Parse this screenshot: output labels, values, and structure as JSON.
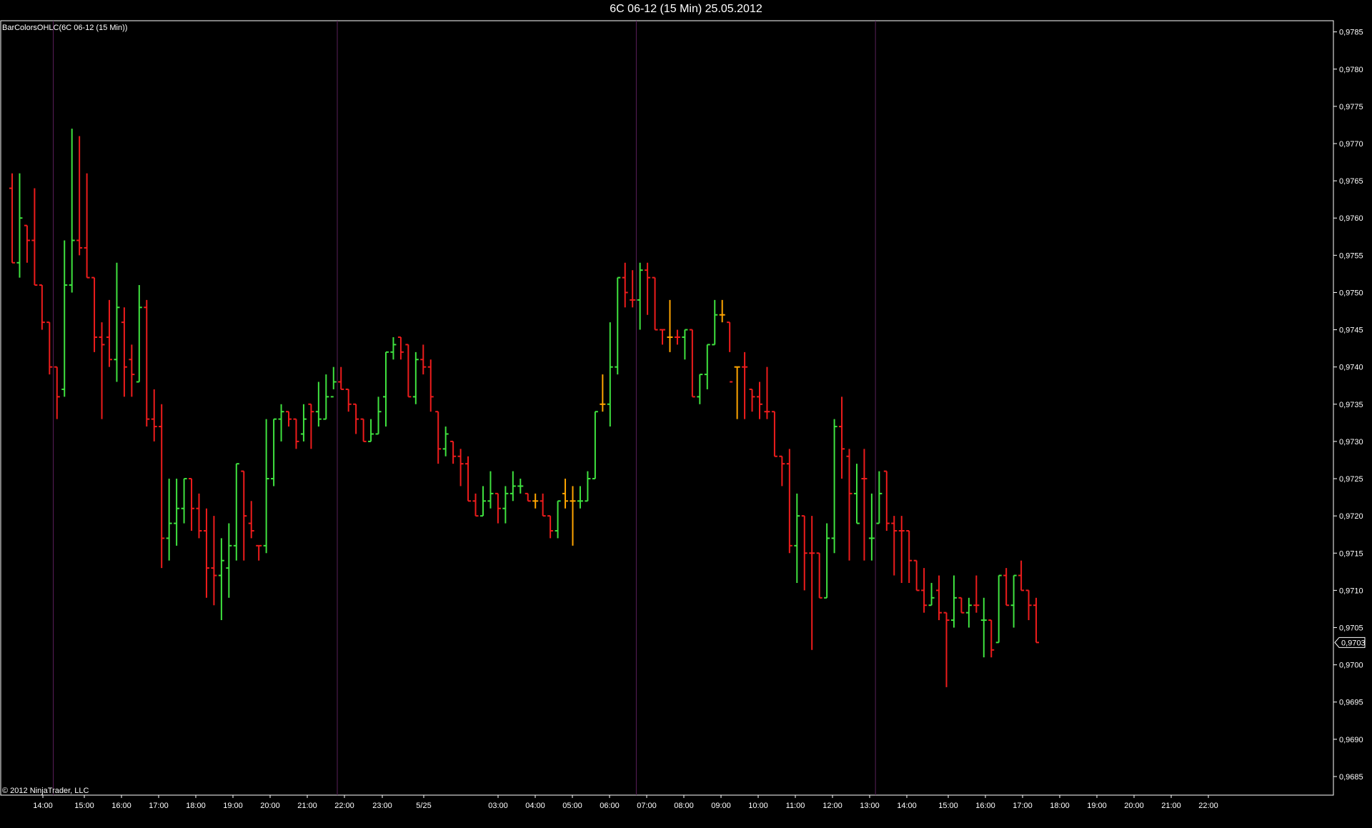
{
  "window": {
    "title": "6C 06-12 (15 Min)  25.05.2012",
    "indicator_label": "BarColorsOHLC(6C 06-12 (15 Min))",
    "copyright": "© 2012 NinjaTrader, LLC"
  },
  "colors": {
    "background": "#000000",
    "axis": "#ffffff",
    "separator": "#5a1f5a",
    "up": "#3fe23f",
    "down": "#ee1c1c",
    "neutral": "#ffa500"
  },
  "chart_data": {
    "type": "ohlc",
    "title": "6C 06-12 (15 Min)  25.05.2012",
    "ylim": [
      0.96825,
      0.97865
    ],
    "y_ticks": [
      "0,9685",
      "0,9690",
      "0,9695",
      "0,9700",
      "0,9705",
      "0,9710",
      "0,9715",
      "0,9720",
      "0,9725",
      "0,9730",
      "0,9735",
      "0,9740",
      "0,9745",
      "0,9750",
      "0,9755",
      "0,9760",
      "0,9765",
      "0,9770",
      "0,9775",
      "0,9780",
      "0,9785"
    ],
    "x_ticks": [
      "14:00",
      "15:00",
      "16:00",
      "17:00",
      "18:00",
      "19:00",
      "20:00",
      "21:00",
      "22:00",
      "23:00",
      "5/25",
      "03:00",
      "04:00",
      "05:00",
      "06:00",
      "07:00",
      "08:00",
      "09:00",
      "10:00",
      "11:00",
      "12:00",
      "13:00",
      "14:00",
      "15:00",
      "16:00",
      "17:00",
      "18:00",
      "19:00",
      "20:00",
      "21:00",
      "22:00"
    ],
    "last_price_label": "0,9703",
    "last_price": 0.9703,
    "session_breaks_after_bar": [
      5,
      43,
      83,
      115
    ],
    "bars": [
      {
        "o": 0.9764,
        "h": 0.9766,
        "l": 0.9754,
        "c": 0.9754,
        "col": "down"
      },
      {
        "o": 0.9754,
        "h": 0.9766,
        "l": 0.9752,
        "c": 0.976,
        "col": "up"
      },
      {
        "o": 0.9759,
        "h": 0.9759,
        "l": 0.9754,
        "c": 0.9757,
        "col": "down"
      },
      {
        "o": 0.9757,
        "h": 0.9764,
        "l": 0.9751,
        "c": 0.9751,
        "col": "down"
      },
      {
        "o": 0.9751,
        "h": 0.9751,
        "l": 0.9745,
        "c": 0.9746,
        "col": "down"
      },
      {
        "o": 0.9746,
        "h": 0.9746,
        "l": 0.9739,
        "c": 0.974,
        "col": "down"
      },
      {
        "o": 0.974,
        "h": 0.974,
        "l": 0.9733,
        "c": 0.9736,
        "col": "down"
      },
      {
        "o": 0.9737,
        "h": 0.9757,
        "l": 0.9736,
        "c": 0.9751,
        "col": "up"
      },
      {
        "o": 0.9751,
        "h": 0.9772,
        "l": 0.975,
        "c": 0.9757,
        "col": "up"
      },
      {
        "o": 0.9757,
        "h": 0.9771,
        "l": 0.9755,
        "c": 0.9756,
        "col": "down"
      },
      {
        "o": 0.9756,
        "h": 0.9766,
        "l": 0.9752,
        "c": 0.9752,
        "col": "down"
      },
      {
        "o": 0.9752,
        "h": 0.9752,
        "l": 0.9742,
        "c": 0.9744,
        "col": "down"
      },
      {
        "o": 0.9744,
        "h": 0.9746,
        "l": 0.9733,
        "c": 0.9743,
        "col": "down"
      },
      {
        "o": 0.9744,
        "h": 0.9749,
        "l": 0.974,
        "c": 0.9741,
        "col": "down"
      },
      {
        "o": 0.9741,
        "h": 0.9754,
        "l": 0.9738,
        "c": 0.9748,
        "col": "up"
      },
      {
        "o": 0.9746,
        "h": 0.9748,
        "l": 0.9736,
        "c": 0.974,
        "col": "down"
      },
      {
        "o": 0.9741,
        "h": 0.9743,
        "l": 0.9736,
        "c": 0.9739,
        "col": "down"
      },
      {
        "o": 0.9738,
        "h": 0.9751,
        "l": 0.9738,
        "c": 0.9748,
        "col": "up"
      },
      {
        "o": 0.9748,
        "h": 0.9749,
        "l": 0.9732,
        "c": 0.9733,
        "col": "down"
      },
      {
        "o": 0.9733,
        "h": 0.9737,
        "l": 0.973,
        "c": 0.9732,
        "col": "down"
      },
      {
        "o": 0.9732,
        "h": 0.9735,
        "l": 0.9713,
        "c": 0.9717,
        "col": "down"
      },
      {
        "o": 0.9717,
        "h": 0.9725,
        "l": 0.9714,
        "c": 0.9719,
        "col": "up"
      },
      {
        "o": 0.9719,
        "h": 0.9725,
        "l": 0.9716,
        "c": 0.9721,
        "col": "up"
      },
      {
        "o": 0.9721,
        "h": 0.9725,
        "l": 0.9719,
        "c": 0.9725,
        "col": "up"
      },
      {
        "o": 0.9725,
        "h": 0.9725,
        "l": 0.9718,
        "c": 0.9721,
        "col": "down"
      },
      {
        "o": 0.9721,
        "h": 0.9723,
        "l": 0.9717,
        "c": 0.9718,
        "col": "down"
      },
      {
        "o": 0.9718,
        "h": 0.9721,
        "l": 0.9709,
        "c": 0.9713,
        "col": "down"
      },
      {
        "o": 0.9713,
        "h": 0.972,
        "l": 0.9708,
        "c": 0.9712,
        "col": "down"
      },
      {
        "o": 0.9712,
        "h": 0.9717,
        "l": 0.9706,
        "c": 0.9714,
        "col": "up"
      },
      {
        "o": 0.9713,
        "h": 0.9719,
        "l": 0.9709,
        "c": 0.9716,
        "col": "up"
      },
      {
        "o": 0.9716,
        "h": 0.9727,
        "l": 0.9714,
        "c": 0.9727,
        "col": "up"
      },
      {
        "o": 0.9726,
        "h": 0.9726,
        "l": 0.9714,
        "c": 0.972,
        "col": "down"
      },
      {
        "o": 0.9719,
        "h": 0.9722,
        "l": 0.9717,
        "c": 0.9718,
        "col": "down"
      },
      {
        "o": 0.9716,
        "h": 0.9716,
        "l": 0.9714,
        "c": 0.9716,
        "col": "down"
      },
      {
        "o": 0.9716,
        "h": 0.9733,
        "l": 0.9715,
        "c": 0.9725,
        "col": "up"
      },
      {
        "o": 0.9725,
        "h": 0.9733,
        "l": 0.9724,
        "c": 0.9733,
        "col": "up"
      },
      {
        "o": 0.9733,
        "h": 0.9735,
        "l": 0.973,
        "c": 0.9734,
        "col": "up"
      },
      {
        "o": 0.9734,
        "h": 0.9734,
        "l": 0.9732,
        "c": 0.9733,
        "col": "down"
      },
      {
        "o": 0.9733,
        "h": 0.9733,
        "l": 0.9729,
        "c": 0.973,
        "col": "down"
      },
      {
        "o": 0.9731,
        "h": 0.9735,
        "l": 0.973,
        "c": 0.9733,
        "col": "up"
      },
      {
        "o": 0.9735,
        "h": 0.9735,
        "l": 0.9729,
        "c": 0.9734,
        "col": "down"
      },
      {
        "o": 0.9734,
        "h": 0.9738,
        "l": 0.9732,
        "c": 0.9733,
        "col": "up"
      },
      {
        "o": 0.9733,
        "h": 0.9739,
        "l": 0.9733,
        "c": 0.9736,
        "col": "up"
      },
      {
        "o": 0.9736,
        "h": 0.974,
        "l": 0.9737,
        "c": 0.9738,
        "col": "up"
      },
      {
        "o": 0.9738,
        "h": 0.974,
        "l": 0.9737,
        "c": 0.9737,
        "col": "down"
      },
      {
        "o": 0.9737,
        "h": 0.9737,
        "l": 0.9734,
        "c": 0.9735,
        "col": "down"
      },
      {
        "o": 0.9735,
        "h": 0.9735,
        "l": 0.9731,
        "c": 0.9733,
        "col": "down"
      },
      {
        "o": 0.9733,
        "h": 0.9733,
        "l": 0.973,
        "c": 0.973,
        "col": "down"
      },
      {
        "o": 0.973,
        "h": 0.9733,
        "l": 0.973,
        "c": 0.9731,
        "col": "up"
      },
      {
        "o": 0.9731,
        "h": 0.9736,
        "l": 0.9731,
        "c": 0.9734,
        "col": "up"
      },
      {
        "o": 0.9736,
        "h": 0.9742,
        "l": 0.9732,
        "c": 0.9742,
        "col": "up"
      },
      {
        "o": 0.9742,
        "h": 0.9744,
        "l": 0.9741,
        "c": 0.9743,
        "col": "up"
      },
      {
        "o": 0.9744,
        "h": 0.9744,
        "l": 0.9741,
        "c": 0.9742,
        "col": "down"
      },
      {
        "o": 0.9743,
        "h": 0.9743,
        "l": 0.9736,
        "c": 0.9736,
        "col": "down"
      },
      {
        "o": 0.9736,
        "h": 0.9742,
        "l": 0.9735,
        "c": 0.9741,
        "col": "up"
      },
      {
        "o": 0.9741,
        "h": 0.9743,
        "l": 0.9739,
        "c": 0.974,
        "col": "down"
      },
      {
        "o": 0.974,
        "h": 0.9741,
        "l": 0.9734,
        "c": 0.9736,
        "col": "down"
      },
      {
        "o": 0.9734,
        "h": 0.9734,
        "l": 0.9727,
        "c": 0.9729,
        "col": "down"
      },
      {
        "o": 0.9729,
        "h": 0.9732,
        "l": 0.9728,
        "c": 0.9731,
        "col": "up"
      },
      {
        "o": 0.973,
        "h": 0.973,
        "l": 0.9727,
        "c": 0.9728,
        "col": "down"
      },
      {
        "o": 0.9728,
        "h": 0.9729,
        "l": 0.9724,
        "c": 0.9727,
        "col": "down"
      },
      {
        "o": 0.9727,
        "h": 0.9728,
        "l": 0.9722,
        "c": 0.9722,
        "col": "down"
      },
      {
        "o": 0.9722,
        "h": 0.9723,
        "l": 0.972,
        "c": 0.972,
        "col": "down"
      },
      {
        "o": 0.972,
        "h": 0.9724,
        "l": 0.972,
        "c": 0.9722,
        "col": "up"
      },
      {
        "o": 0.9722,
        "h": 0.9726,
        "l": 0.9721,
        "c": 0.9723,
        "col": "up"
      },
      {
        "o": 0.9723,
        "h": 0.9723,
        "l": 0.9719,
        "c": 0.9721,
        "col": "down"
      },
      {
        "o": 0.9721,
        "h": 0.9724,
        "l": 0.9719,
        "c": 0.9723,
        "col": "up"
      },
      {
        "o": 0.9723,
        "h": 0.9726,
        "l": 0.9722,
        "c": 0.9724,
        "col": "up"
      },
      {
        "o": 0.9724,
        "h": 0.9725,
        "l": 0.9723,
        "c": 0.9724,
        "col": "up"
      },
      {
        "o": 0.9723,
        "h": 0.9723,
        "l": 0.9722,
        "c": 0.9722,
        "col": "down"
      },
      {
        "o": 0.9722,
        "h": 0.9723,
        "l": 0.9721,
        "c": 0.9722,
        "col": "neutral"
      },
      {
        "o": 0.9722,
        "h": 0.9723,
        "l": 0.972,
        "c": 0.972,
        "col": "down"
      },
      {
        "o": 0.972,
        "h": 0.972,
        "l": 0.9717,
        "c": 0.9718,
        "col": "down"
      },
      {
        "o": 0.9718,
        "h": 0.9722,
        "l": 0.9717,
        "c": 0.9722,
        "col": "up"
      },
      {
        "o": 0.9723,
        "h": 0.9725,
        "l": 0.9721,
        "c": 0.9722,
        "col": "neutral"
      },
      {
        "o": 0.9722,
        "h": 0.9724,
        "l": 0.9716,
        "c": 0.9722,
        "col": "neutral"
      },
      {
        "o": 0.9722,
        "h": 0.9724,
        "l": 0.9721,
        "c": 0.9722,
        "col": "up"
      },
      {
        "o": 0.9722,
        "h": 0.9726,
        "l": 0.9722,
        "c": 0.9725,
        "col": "up"
      },
      {
        "o": 0.9725,
        "h": 0.9734,
        "l": 0.9725,
        "c": 0.9734,
        "col": "up"
      },
      {
        "o": 0.9735,
        "h": 0.9739,
        "l": 0.9734,
        "c": 0.9735,
        "col": "neutral"
      },
      {
        "o": 0.9735,
        "h": 0.9746,
        "l": 0.9732,
        "c": 0.974,
        "col": "up"
      },
      {
        "o": 0.974,
        "h": 0.9752,
        "l": 0.9739,
        "c": 0.9752,
        "col": "up"
      },
      {
        "o": 0.9752,
        "h": 0.9754,
        "l": 0.9748,
        "c": 0.975,
        "col": "down"
      },
      {
        "o": 0.9749,
        "h": 0.9753,
        "l": 0.9748,
        "c": 0.9749,
        "col": "down"
      },
      {
        "o": 0.9749,
        "h": 0.9754,
        "l": 0.9745,
        "c": 0.9753,
        "col": "up"
      },
      {
        "o": 0.9753,
        "h": 0.9754,
        "l": 0.9747,
        "c": 0.9752,
        "col": "down"
      },
      {
        "o": 0.9752,
        "h": 0.9752,
        "l": 0.9745,
        "c": 0.9745,
        "col": "down"
      },
      {
        "o": 0.9745,
        "h": 0.9745,
        "l": 0.9743,
        "c": 0.9745,
        "col": "down"
      },
      {
        "o": 0.9744,
        "h": 0.9749,
        "l": 0.9742,
        "c": 0.9744,
        "col": "neutral"
      },
      {
        "o": 0.9744,
        "h": 0.9745,
        "l": 0.9743,
        "c": 0.9744,
        "col": "down"
      },
      {
        "o": 0.9744,
        "h": 0.9745,
        "l": 0.9741,
        "c": 0.9745,
        "col": "up"
      },
      {
        "o": 0.9745,
        "h": 0.9745,
        "l": 0.9736,
        "c": 0.9736,
        "col": "down"
      },
      {
        "o": 0.9736,
        "h": 0.9739,
        "l": 0.9735,
        "c": 0.9739,
        "col": "up"
      },
      {
        "o": 0.9739,
        "h": 0.9743,
        "l": 0.9737,
        "c": 0.9743,
        "col": "up"
      },
      {
        "o": 0.9743,
        "h": 0.9749,
        "l": 0.9743,
        "c": 0.9747,
        "col": "up"
      },
      {
        "o": 0.9747,
        "h": 0.9749,
        "l": 0.9746,
        "c": 0.9747,
        "col": "neutral"
      },
      {
        "o": 0.9746,
        "h": 0.9746,
        "l": 0.9742,
        "c": 0.9738,
        "col": "down"
      },
      {
        "o": 0.974,
        "h": 0.974,
        "l": 0.9733,
        "c": 0.974,
        "col": "neutral"
      },
      {
        "o": 0.974,
        "h": 0.9742,
        "l": 0.9733,
        "c": 0.974,
        "col": "down"
      },
      {
        "o": 0.9737,
        "h": 0.9737,
        "l": 0.9734,
        "c": 0.9736,
        "col": "down"
      },
      {
        "o": 0.9736,
        "h": 0.9738,
        "l": 0.9733,
        "c": 0.9735,
        "col": "down"
      },
      {
        "o": 0.9734,
        "h": 0.974,
        "l": 0.9733,
        "c": 0.9734,
        "col": "down"
      },
      {
        "o": 0.9734,
        "h": 0.9734,
        "l": 0.9728,
        "c": 0.9728,
        "col": "down"
      },
      {
        "o": 0.9728,
        "h": 0.9728,
        "l": 0.9724,
        "c": 0.9727,
        "col": "down"
      },
      {
        "o": 0.9727,
        "h": 0.9729,
        "l": 0.9715,
        "c": 0.9716,
        "col": "down"
      },
      {
        "o": 0.9716,
        "h": 0.9723,
        "l": 0.9711,
        "c": 0.972,
        "col": "up"
      },
      {
        "o": 0.972,
        "h": 0.972,
        "l": 0.971,
        "c": 0.9715,
        "col": "down"
      },
      {
        "o": 0.9715,
        "h": 0.972,
        "l": 0.9702,
        "c": 0.9715,
        "col": "down"
      },
      {
        "o": 0.9715,
        "h": 0.9715,
        "l": 0.9709,
        "c": 0.9709,
        "col": "down"
      },
      {
        "o": 0.9709,
        "h": 0.9719,
        "l": 0.9709,
        "c": 0.9717,
        "col": "up"
      },
      {
        "o": 0.9717,
        "h": 0.9733,
        "l": 0.9715,
        "c": 0.9732,
        "col": "up"
      },
      {
        "o": 0.9732,
        "h": 0.9736,
        "l": 0.9725,
        "c": 0.9729,
        "col": "down"
      },
      {
        "o": 0.9728,
        "h": 0.9729,
        "l": 0.9714,
        "c": 0.9723,
        "col": "down"
      },
      {
        "o": 0.9723,
        "h": 0.9727,
        "l": 0.9719,
        "c": 0.9719,
        "col": "up"
      },
      {
        "o": 0.9725,
        "h": 0.9729,
        "l": 0.9714,
        "c": 0.9725,
        "col": "down"
      },
      {
        "o": 0.9717,
        "h": 0.9723,
        "l": 0.9714,
        "c": 0.9717,
        "col": "up"
      },
      {
        "o": 0.9719,
        "h": 0.9726,
        "l": 0.9719,
        "c": 0.9723,
        "col": "up"
      },
      {
        "o": 0.9726,
        "h": 0.9726,
        "l": 0.9718,
        "c": 0.9719,
        "col": "down"
      },
      {
        "o": 0.9719,
        "h": 0.972,
        "l": 0.9712,
        "c": 0.9718,
        "col": "down"
      },
      {
        "o": 0.9718,
        "h": 0.972,
        "l": 0.9711,
        "c": 0.9718,
        "col": "down"
      },
      {
        "o": 0.9718,
        "h": 0.9718,
        "l": 0.9711,
        "c": 0.9714,
        "col": "down"
      },
      {
        "o": 0.9714,
        "h": 0.9714,
        "l": 0.971,
        "c": 0.971,
        "col": "down"
      },
      {
        "o": 0.971,
        "h": 0.9713,
        "l": 0.9707,
        "c": 0.9708,
        "col": "down"
      },
      {
        "o": 0.9708,
        "h": 0.9711,
        "l": 0.9708,
        "c": 0.9709,
        "col": "up"
      },
      {
        "o": 0.971,
        "h": 0.9712,
        "l": 0.9706,
        "c": 0.9707,
        "col": "down"
      },
      {
        "o": 0.9707,
        "h": 0.9707,
        "l": 0.9697,
        "c": 0.9706,
        "col": "down"
      },
      {
        "o": 0.9706,
        "h": 0.9712,
        "l": 0.9705,
        "c": 0.9709,
        "col": "up"
      },
      {
        "o": 0.9709,
        "h": 0.9709,
        "l": 0.9707,
        "c": 0.9707,
        "col": "down"
      },
      {
        "o": 0.9707,
        "h": 0.9709,
        "l": 0.9705,
        "c": 0.9708,
        "col": "up"
      },
      {
        "o": 0.9708,
        "h": 0.9712,
        "l": 0.9707,
        "c": 0.9708,
        "col": "down"
      },
      {
        "o": 0.9706,
        "h": 0.9709,
        "l": 0.9701,
        "c": 0.9706,
        "col": "up"
      },
      {
        "o": 0.9706,
        "h": 0.9706,
        "l": 0.9701,
        "c": 0.9702,
        "col": "down"
      },
      {
        "o": 0.9703,
        "h": 0.9712,
        "l": 0.9703,
        "c": 0.9712,
        "col": "up"
      },
      {
        "o": 0.9712,
        "h": 0.9713,
        "l": 0.9708,
        "c": 0.9708,
        "col": "down"
      },
      {
        "o": 0.9708,
        "h": 0.9712,
        "l": 0.9705,
        "c": 0.9712,
        "col": "up"
      },
      {
        "o": 0.9712,
        "h": 0.9714,
        "l": 0.971,
        "c": 0.971,
        "col": "down"
      },
      {
        "o": 0.971,
        "h": 0.971,
        "l": 0.9706,
        "c": 0.9708,
        "col": "down"
      },
      {
        "o": 0.9708,
        "h": 0.9709,
        "l": 0.9703,
        "c": 0.9703,
        "col": "down"
      }
    ]
  }
}
